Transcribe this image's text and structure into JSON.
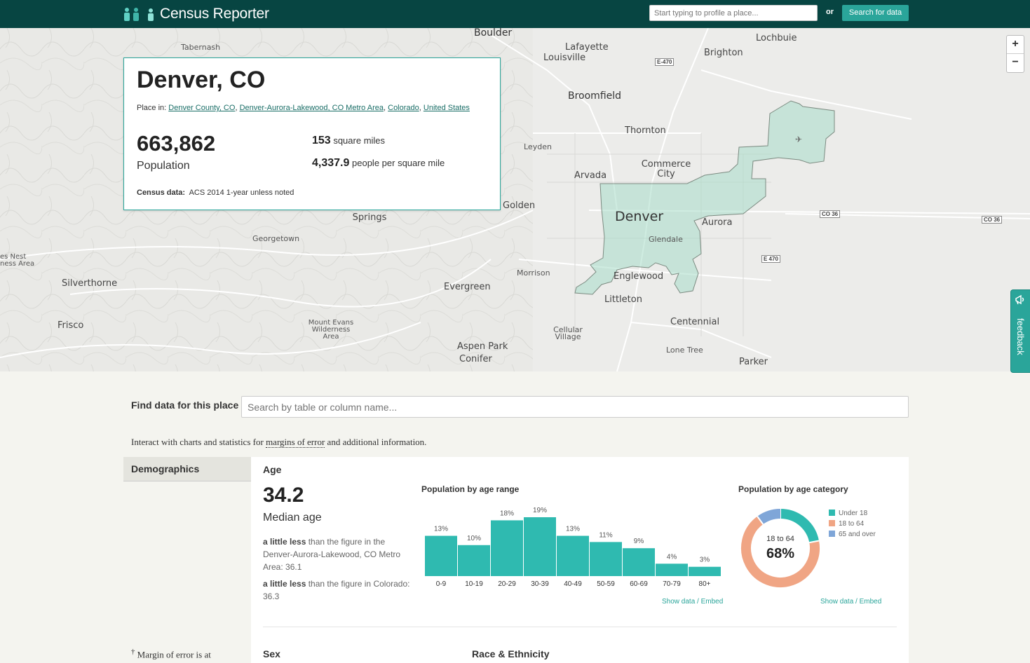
{
  "header": {
    "brand": "Census Reporter",
    "search_placeholder": "Start typing to profile a place...",
    "or_label": "or",
    "search_button": "Search for data"
  },
  "map": {
    "labels": [
      "Boulder",
      "Tabernash",
      "Lafayette",
      "Louisville",
      "Lochbuie",
      "Brighton",
      "Broomfield",
      "Thornton",
      "Leyden",
      "Commerce City",
      "Arvada",
      "Golden",
      "Idaho Springs",
      "Denver",
      "Aurora",
      "Glendale",
      "Georgetown",
      "Morrison",
      "Silverthorne",
      "Evergreen",
      "Englewood",
      "Littleton",
      "Frisco",
      "Mount Evans Wilderness Area",
      "Centennial",
      "Cellular Village",
      "Aspen Park",
      "Conifer",
      "Lone Tree",
      "Parker",
      "es Nest ness Area"
    ],
    "shields": [
      "E-470",
      "CO 36",
      "CO 36",
      "E 470"
    ],
    "zoom_in": "+",
    "zoom_out": "−",
    "feedback": "feedback"
  },
  "profile": {
    "name": "Denver, CO",
    "place_in_label": "Place in:",
    "parents": [
      "Denver County, CO",
      "Denver-Aurora-Lakewood, CO Metro Area",
      "Colorado",
      "United States"
    ],
    "population_value": "663,862",
    "population_label": "Population",
    "area_value": "153",
    "area_label": "square miles",
    "density_value": "4,337.9",
    "density_label": "people per square mile",
    "census_data_label": "Census data:",
    "census_data_value": "ACS 2014 1-year unless noted"
  },
  "find_data": {
    "label": "Find data for this place",
    "placeholder": "Search by table or column name..."
  },
  "interact_text_pre": "Interact with charts and statistics for ",
  "interact_link": "margins of error",
  "interact_text_post": " and additional information.",
  "sidebar": {
    "tab": "Demographics",
    "moe_dagger": "†",
    "moe_text": "Margin of error is at"
  },
  "age": {
    "title": "Age",
    "median_value": "34.2",
    "median_label": "Median age",
    "compare_1_bold": "a little less",
    "compare_1_text": " than the figure in the Denver-Aurora-Lakewood, CO Metro Area: 36.1",
    "compare_2_bold": "a little less",
    "compare_2_text": " than the figure in Colorado: 36.3",
    "range_chart_title": "Population by age range",
    "category_chart_title": "Population by age category",
    "donut_label": "18 to 64",
    "donut_value": "68%",
    "show_data": "Show data / Embed"
  },
  "next_sections": {
    "sex": "Sex",
    "race": "Race & Ethnicity"
  },
  "colors": {
    "teal": "#2fbab0",
    "salmon": "#f0a584",
    "blue": "#7fa6d8",
    "header": "#074542"
  },
  "chart_data": [
    {
      "type": "bar",
      "title": "Population by age range",
      "categories": [
        "0-9",
        "10-19",
        "20-29",
        "30-39",
        "40-49",
        "50-59",
        "60-69",
        "70-79",
        "80+"
      ],
      "values": [
        13,
        10,
        18,
        19,
        13,
        11,
        9,
        4,
        3
      ],
      "value_labels": [
        "13%",
        "10%",
        "18%",
        "19%",
        "13%",
        "11%",
        "9%",
        "4%",
        "3%"
      ],
      "ylim": [
        0,
        19
      ]
    },
    {
      "type": "pie",
      "title": "Population by age category",
      "categories": [
        "Under 18",
        "18 to 64",
        "65 and over"
      ],
      "values": [
        22,
        68,
        10
      ]
    }
  ]
}
